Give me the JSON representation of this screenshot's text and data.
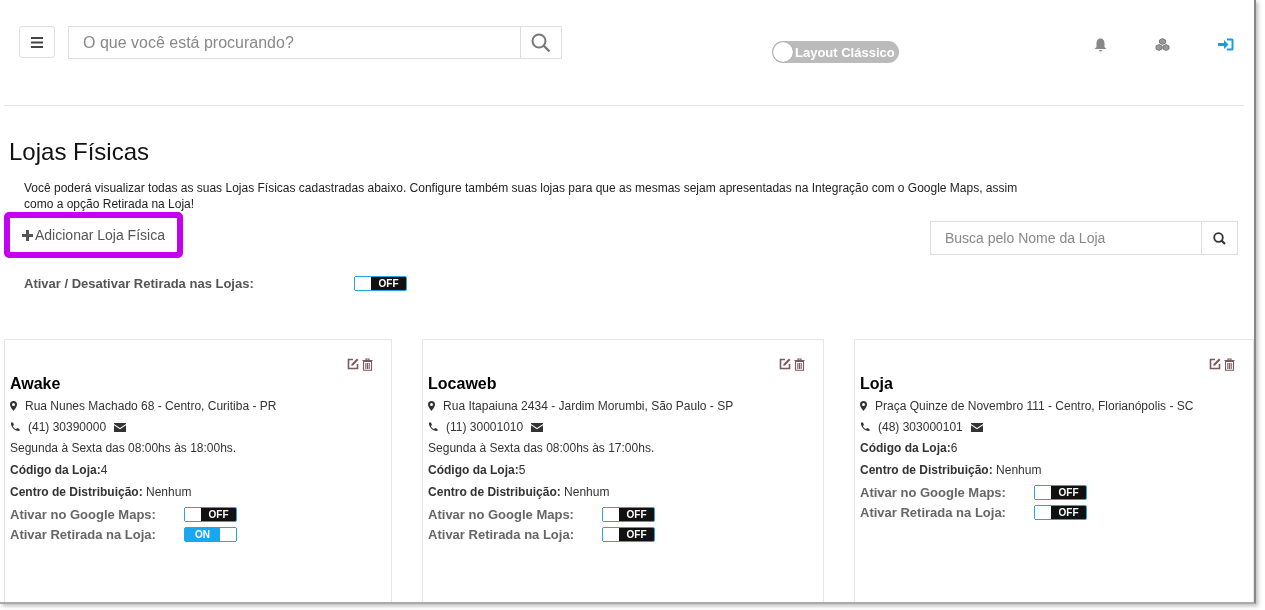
{
  "header": {
    "search": {
      "placeholder": "O que você está procurando?"
    },
    "layout_toggle": {
      "label": "Layout Clássico",
      "on": false
    }
  },
  "page": {
    "title": "Lojas Físicas",
    "description": "Você poderá visualizar todas as suas Lojas Físicas cadastradas abaixo. Configure também suas lojas para que as mesmas sejam apresentadas na Integração com o Google Maps, assim como a opção Retirada na Loja!",
    "add_button": {
      "label": "Adicionar Loja Física",
      "highlighted": true
    },
    "store_search": {
      "placeholder": "Busca pelo Nome da Loja"
    },
    "global_toggle": {
      "label": "Ativar / Desativar Retirada nas Lojas:",
      "on": false,
      "text": "OFF"
    }
  },
  "stores": [
    {
      "name": "Awake",
      "address": "Rua Nunes Machado 68 - Centro, Curitiba - PR",
      "phone": "(41) 30390000",
      "hours": "Segunda à Sexta das 08:00hs às 18:00hs.",
      "code_label": "Código da Loja:",
      "code": "4",
      "distribution_label": "Centro de Distribuição:",
      "distribution": "Nenhum",
      "toggles": [
        {
          "label": "Ativar no Google Maps:",
          "on": false,
          "text": "OFF"
        },
        {
          "label": "Ativar Retirada na Loja:",
          "on": true,
          "text": "ON"
        }
      ]
    },
    {
      "name": "Locaweb",
      "address": "Rua Itapaiuna 2434 - Jardim Morumbi, São Paulo - SP",
      "phone": "(11) 30001010",
      "hours": "Segunda à Sexta das 08:00hs às 17:00hs.",
      "code_label": "Código da Loja:",
      "code": "5",
      "distribution_label": "Centro de Distribuição:",
      "distribution": "Nenhum",
      "toggles": [
        {
          "label": "Ativar no Google Maps:",
          "on": false,
          "text": "OFF"
        },
        {
          "label": "Ativar Retirada na Loja:",
          "on": false,
          "text": "OFF"
        }
      ]
    },
    {
      "name": "Loja",
      "address": "Praça Quinze de Novembro 111 - Centro, Florianópolis - SC",
      "phone": "(48) 303000101",
      "code_label": "Código da Loja:",
      "code": "6",
      "distribution_label": "Centro de Distribuição:",
      "distribution": "Nenhum",
      "toggles": [
        {
          "label": "Ativar no Google Maps:",
          "on": false,
          "text": "OFF"
        },
        {
          "label": "Ativar Retirada na Loja:",
          "on": false,
          "text": "OFF"
        }
      ]
    }
  ]
}
